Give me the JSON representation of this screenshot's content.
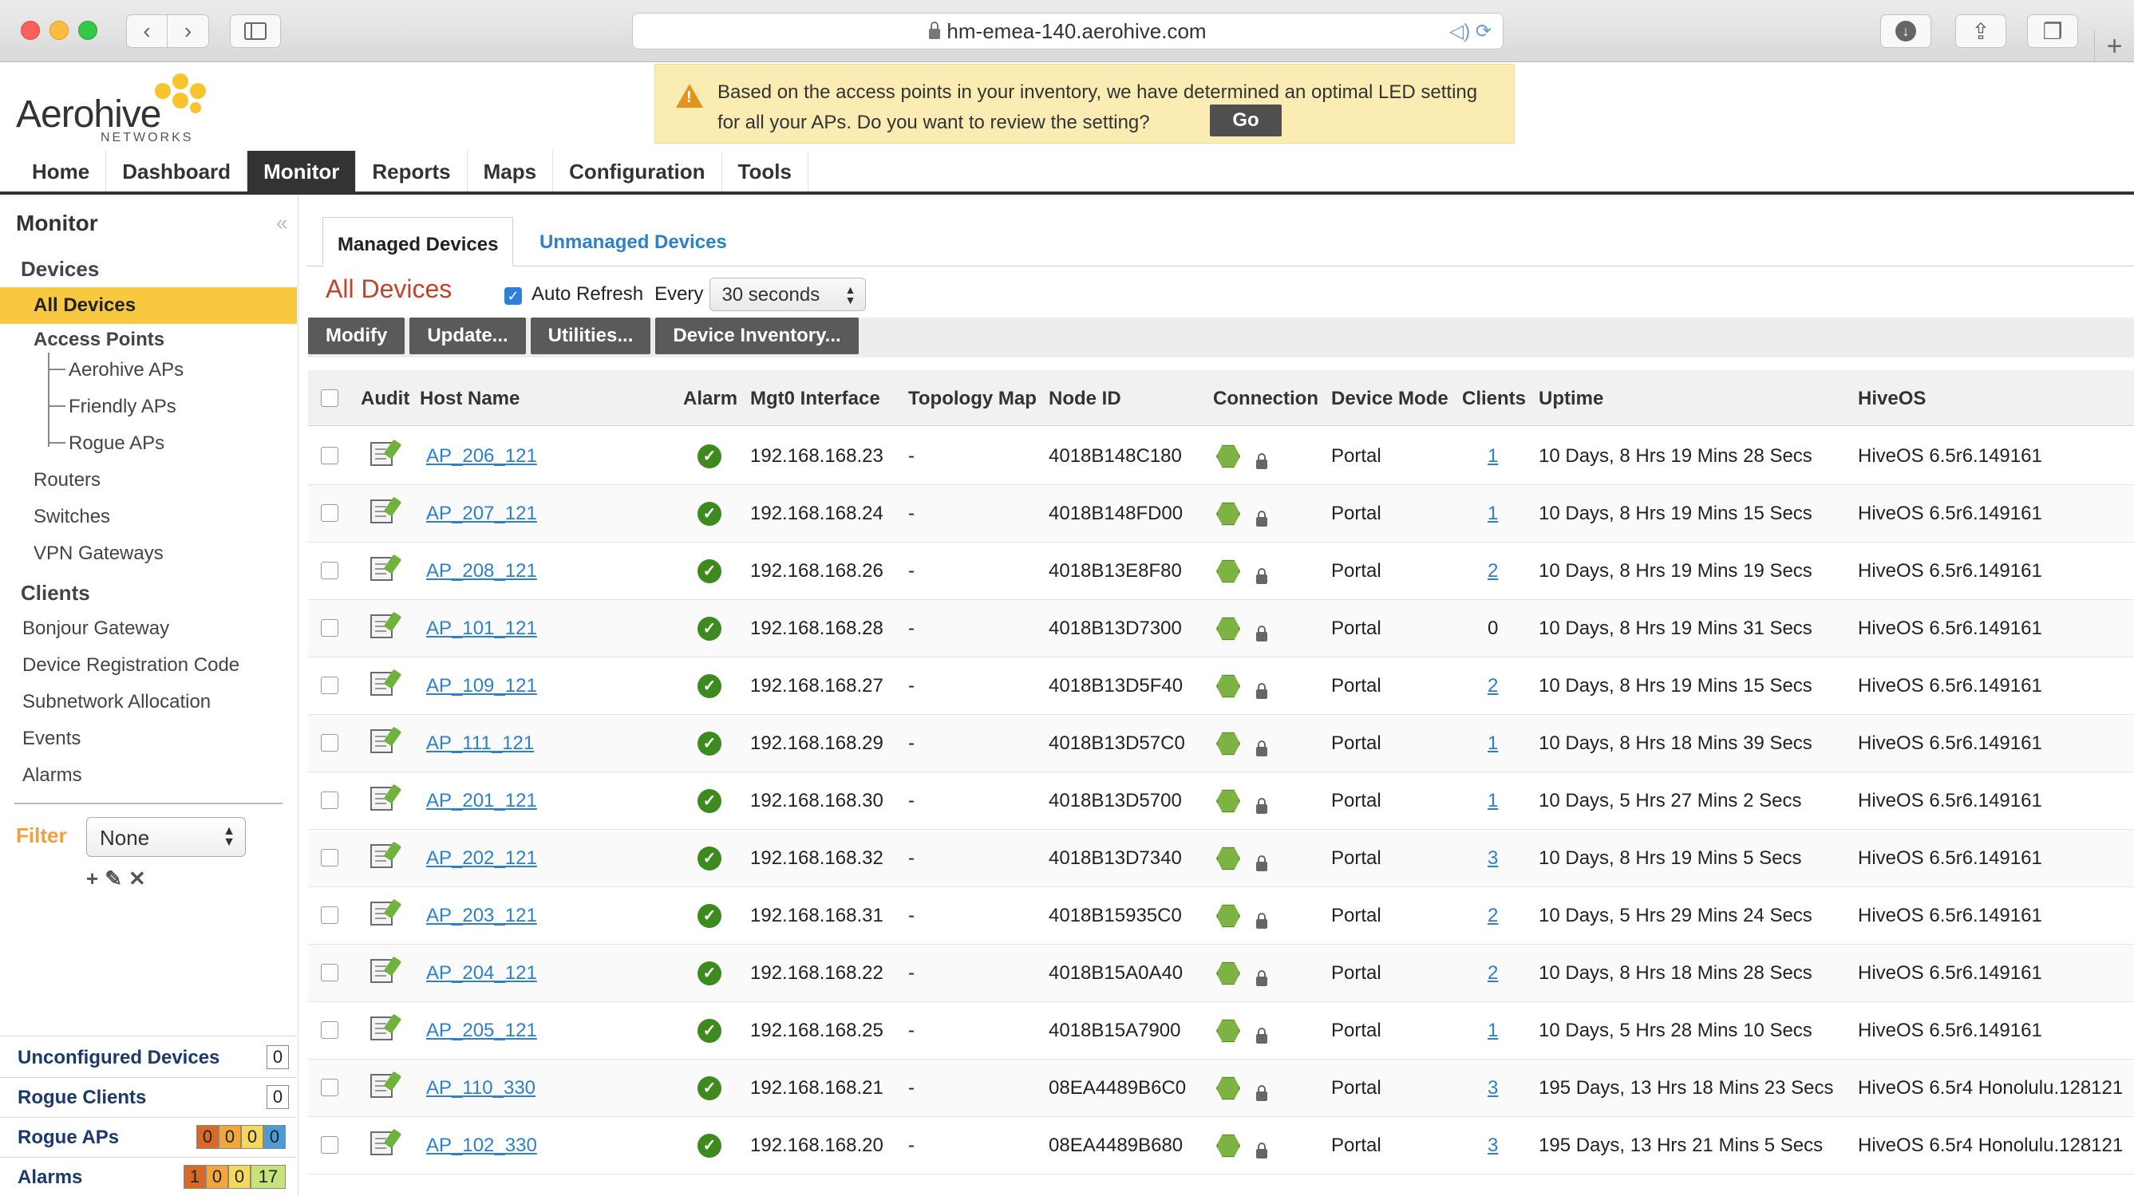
{
  "browser": {
    "url": "hm-emea-140.aerohive.com"
  },
  "brand": {
    "name": "Aerohive",
    "sub": "NETWORKS",
    "accent": "#f7c430"
  },
  "banner": {
    "message": "Based on the access points in your inventory, we have determined an optimal LED setting for all your APs. Do you want to review the setting?",
    "button": "Go"
  },
  "nav": {
    "items": [
      "Home",
      "Dashboard",
      "Monitor",
      "Reports",
      "Maps",
      "Configuration",
      "Tools"
    ],
    "active": "Monitor"
  },
  "sidebar": {
    "title": "Monitor",
    "devices_heading": "Devices",
    "all_devices": "All Devices",
    "access_points": "Access Points",
    "aerohive_aps": "Aerohive APs",
    "friendly_aps": "Friendly APs",
    "rogue_aps": "Rogue APs",
    "routers": "Routers",
    "switches": "Switches",
    "vpn_gateways": "VPN Gateways",
    "clients_heading": "Clients",
    "bonjour_gateway": "Bonjour Gateway",
    "device_registration_code": "Device Registration Code",
    "subnetwork_allocation": "Subnetwork Allocation",
    "events": "Events",
    "alarms": "Alarms",
    "filter_label": "Filter",
    "filter_value": "None"
  },
  "summary": {
    "unconfigured_devices": {
      "label": "Unconfigured Devices",
      "value": "0"
    },
    "rogue_clients": {
      "label": "Rogue Clients",
      "value": "0"
    },
    "rogue_aps": {
      "label": "Rogue APs",
      "values": [
        "0",
        "0",
        "0",
        "0"
      ]
    },
    "alarms": {
      "label": "Alarms",
      "values": [
        "1",
        "0",
        "0",
        "17"
      ]
    }
  },
  "content": {
    "tab_managed": "Managed Devices",
    "tab_unmanaged": "Unmanaged Devices",
    "page_title": "All Devices",
    "auto_refresh_label": "Auto Refresh",
    "every_label": "Every",
    "refresh_interval": "30 seconds",
    "buttons": {
      "modify": "Modify",
      "update": "Update...",
      "utilities": "Utilities...",
      "device_inventory": "Device Inventory..."
    },
    "columns": {
      "audit": "Audit",
      "host": "Host Name",
      "alarm": "Alarm",
      "mgt0": "Mgt0 Interface",
      "topology": "Topology Map",
      "node": "Node ID",
      "connection": "Connection",
      "mode": "Device Mode",
      "clients": "Clients",
      "uptime": "Uptime",
      "hiveos": "HiveOS"
    },
    "rows": [
      {
        "host": "AP_206_121",
        "ip": "192.168.168.23",
        "topo": "-",
        "node": "4018B148C180",
        "mode": "Portal",
        "clients": "1",
        "uptime": "10 Days, 8 Hrs 19 Mins 28 Secs",
        "os": "HiveOS 6.5r6.149161"
      },
      {
        "host": "AP_207_121",
        "ip": "192.168.168.24",
        "topo": "-",
        "node": "4018B148FD00",
        "mode": "Portal",
        "clients": "1",
        "uptime": "10 Days, 8 Hrs 19 Mins 15 Secs",
        "os": "HiveOS 6.5r6.149161"
      },
      {
        "host": "AP_208_121",
        "ip": "192.168.168.26",
        "topo": "-",
        "node": "4018B13E8F80",
        "mode": "Portal",
        "clients": "2",
        "uptime": "10 Days, 8 Hrs 19 Mins 19 Secs",
        "os": "HiveOS 6.5r6.149161"
      },
      {
        "host": "AP_101_121",
        "ip": "192.168.168.28",
        "topo": "-",
        "node": "4018B13D7300",
        "mode": "Portal",
        "clients": "0",
        "uptime": "10 Days, 8 Hrs 19 Mins 31 Secs",
        "os": "HiveOS 6.5r6.149161"
      },
      {
        "host": "AP_109_121",
        "ip": "192.168.168.27",
        "topo": "-",
        "node": "4018B13D5F40",
        "mode": "Portal",
        "clients": "2",
        "uptime": "10 Days, 8 Hrs 19 Mins 15 Secs",
        "os": "HiveOS 6.5r6.149161"
      },
      {
        "host": "AP_111_121",
        "ip": "192.168.168.29",
        "topo": "-",
        "node": "4018B13D57C0",
        "mode": "Portal",
        "clients": "1",
        "uptime": "10 Days, 8 Hrs 18 Mins 39 Secs",
        "os": "HiveOS 6.5r6.149161"
      },
      {
        "host": "AP_201_121",
        "ip": "192.168.168.30",
        "topo": "-",
        "node": "4018B13D5700",
        "mode": "Portal",
        "clients": "1",
        "uptime": "10 Days, 5 Hrs 27 Mins 2 Secs",
        "os": "HiveOS 6.5r6.149161"
      },
      {
        "host": "AP_202_121",
        "ip": "192.168.168.32",
        "topo": "-",
        "node": "4018B13D7340",
        "mode": "Portal",
        "clients": "3",
        "uptime": "10 Days, 8 Hrs 19 Mins 5 Secs",
        "os": "HiveOS 6.5r6.149161"
      },
      {
        "host": "AP_203_121",
        "ip": "192.168.168.31",
        "topo": "-",
        "node": "4018B15935C0",
        "mode": "Portal",
        "clients": "2",
        "uptime": "10 Days, 5 Hrs 29 Mins 24 Secs",
        "os": "HiveOS 6.5r6.149161"
      },
      {
        "host": "AP_204_121",
        "ip": "192.168.168.22",
        "topo": "-",
        "node": "4018B15A0A40",
        "mode": "Portal",
        "clients": "2",
        "uptime": "10 Days, 8 Hrs 18 Mins 28 Secs",
        "os": "HiveOS 6.5r6.149161"
      },
      {
        "host": "AP_205_121",
        "ip": "192.168.168.25",
        "topo": "-",
        "node": "4018B15A7900",
        "mode": "Portal",
        "clients": "1",
        "uptime": "10 Days, 5 Hrs 28 Mins 10 Secs",
        "os": "HiveOS 6.5r6.149161"
      },
      {
        "host": "AP_110_330",
        "ip": "192.168.168.21",
        "topo": "-",
        "node": "08EA4489B6C0",
        "mode": "Portal",
        "clients": "3",
        "uptime": "195 Days, 13 Hrs 18 Mins 23 Secs",
        "os": "HiveOS 6.5r4 Honolulu.128121"
      },
      {
        "host": "AP_102_330",
        "ip": "192.168.168.20",
        "topo": "-",
        "node": "08EA4489B680",
        "mode": "Portal",
        "clients": "3",
        "uptime": "195 Days, 13 Hrs 21 Mins 5 Secs",
        "os": "HiveOS 6.5r4 Honolulu.128121"
      }
    ]
  }
}
